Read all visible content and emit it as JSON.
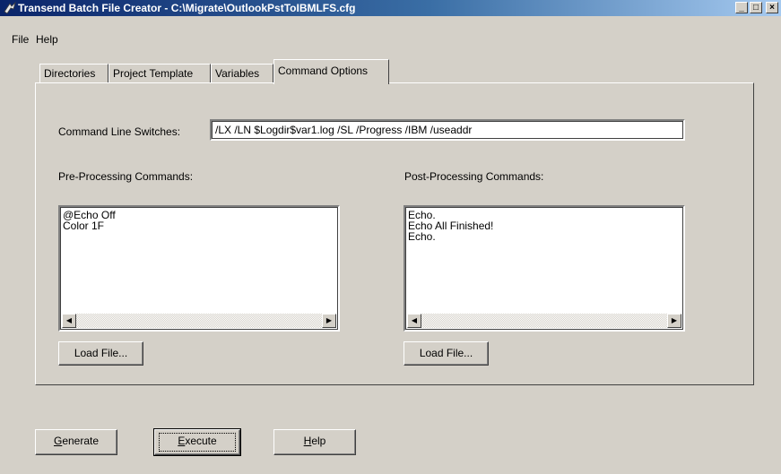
{
  "window": {
    "title": "Transend Batch File Creator - C:\\Migrate\\OutlookPstToIBMLFS.cfg",
    "minimize": "_",
    "maximize": "□",
    "close": "×"
  },
  "menu": {
    "file": "File",
    "help": "Help"
  },
  "tabs": [
    {
      "label": "Directories",
      "active": false
    },
    {
      "label": "Project Template",
      "active": false
    },
    {
      "label": "Variables",
      "active": false
    },
    {
      "label": "Command Options",
      "active": true
    }
  ],
  "command_options": {
    "switches_label": "Command Line Switches:",
    "switches_value": "/LX /LN $Logdir$var1.log /SL /Progress /IBM /useaddr",
    "pre_label": "Pre-Processing Commands:",
    "pre_lines": "@Echo Off\nColor 1F",
    "post_label": "Post-Processing Commands:",
    "post_lines": "Echo.\nEcho All Finished!\nEcho.",
    "load_file_pre": "Load File...",
    "load_file_post": "Load File..."
  },
  "buttons": {
    "generate_accel": "G",
    "generate_rest": "enerate",
    "execute_accel": "E",
    "execute_rest": "xecute",
    "help_accel": "H",
    "help_rest": "elp"
  }
}
